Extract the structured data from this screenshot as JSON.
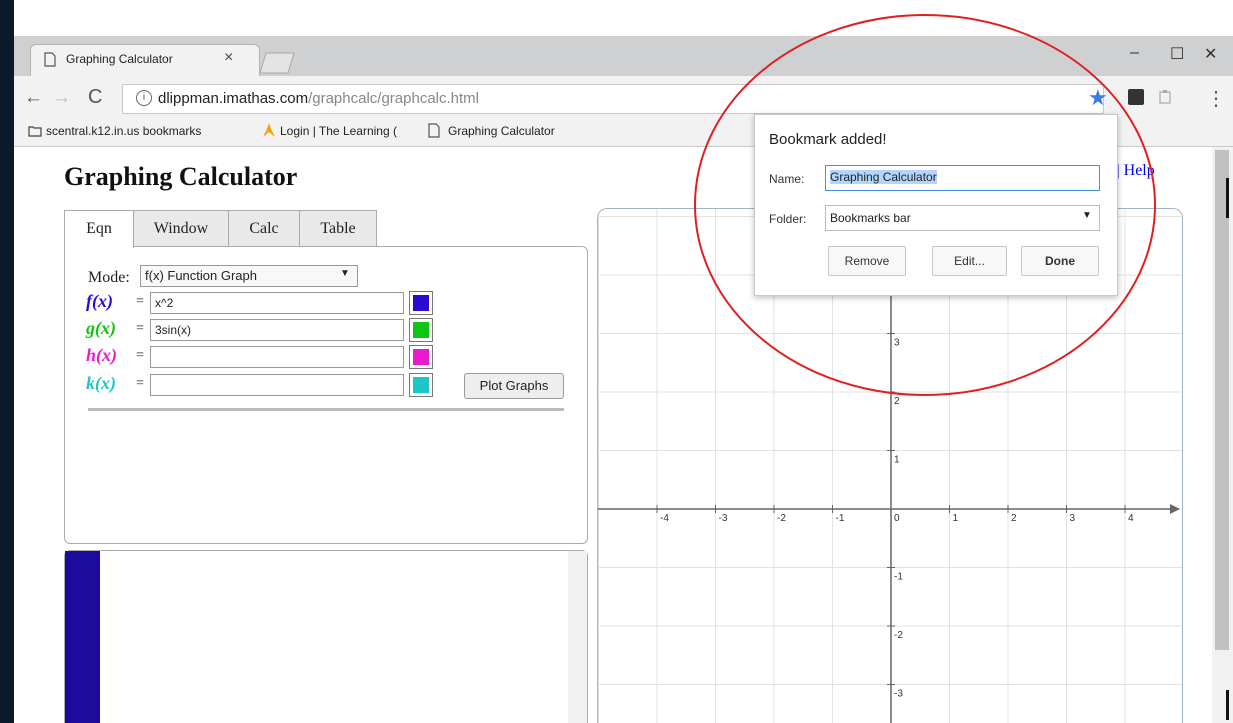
{
  "browser": {
    "tab_title": "Graphing Calculator",
    "tab_close": "×",
    "window_controls": {
      "minimize": "–",
      "maximize": "☐",
      "close": "✕"
    },
    "url_host": "dlippman.imathas.com",
    "url_path": "/graphcalc/graphcalc.html",
    "info_glyph": "i",
    "star_glyph": "★",
    "menu_glyph": "⋮",
    "back_glyph": "←",
    "forward_glyph": "→",
    "reload_glyph": "C",
    "bookmarks": [
      "scentral.k12.in.us bookmarks",
      "Login | The Learning (",
      "Graphing Calculator"
    ],
    "accent_color": "#3d7be5"
  },
  "page": {
    "title": "Graphing Calculator",
    "top_right_link": "t | Help",
    "tabs": [
      "Eqn",
      "Window",
      "Calc",
      "Table"
    ],
    "mode_label": "Mode:",
    "mode_value": "f(x) Function Graph",
    "mode_arrow": "▼",
    "functions": [
      {
        "name": "f(x)",
        "eq": "=",
        "value": "x^2",
        "color": "#2a0bd6"
      },
      {
        "name": "g(x)",
        "eq": "=",
        "value": "3sin(x)",
        "color": "#12c412"
      },
      {
        "name": "h(x)",
        "eq": "=",
        "value": "",
        "color": "#e81ccd"
      },
      {
        "name": "k(x)",
        "eq": "=",
        "value": "",
        "color": "#1fc6c6"
      }
    ],
    "plot_button": "Plot Graphs"
  },
  "graph": {
    "x_ticks": [
      "-4",
      "-3",
      "-2",
      "-1",
      "0",
      "1",
      "2",
      "3",
      "4"
    ],
    "y_ticks": [
      "3",
      "2",
      "1",
      "-1",
      "-2",
      "-3"
    ]
  },
  "bookmark_bubble": {
    "title": "Bookmark added!",
    "name_label": "Name:",
    "name_value": "Graphing Calculator",
    "folder_label": "Folder:",
    "folder_value": "Bookmarks bar",
    "folder_arrow": "▼",
    "remove": "Remove",
    "edit": "Edit...",
    "done": "Done"
  },
  "annotation_color": "#e02020"
}
